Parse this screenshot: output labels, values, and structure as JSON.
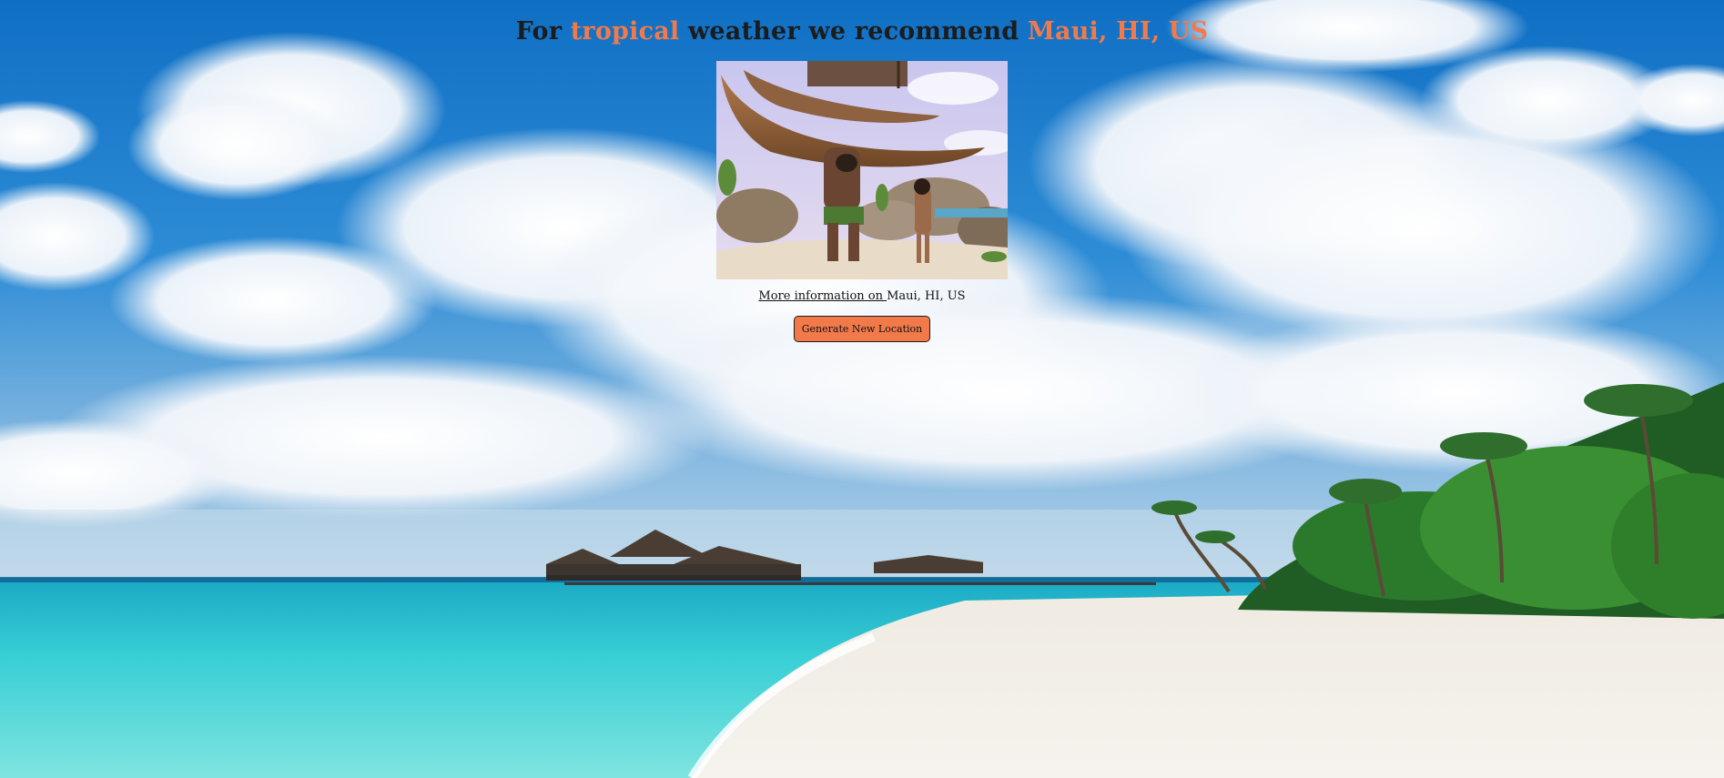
{
  "headline": {
    "prefix": "For ",
    "weather": "tropical",
    "middle": " weather we recommend ",
    "location": "Maui, HI, US"
  },
  "photo": {
    "alt_icon": "destination-photo"
  },
  "info": {
    "link_text": "More information on ",
    "location": "Maui, HI, US"
  },
  "button": {
    "label": "Generate New Location"
  },
  "colors": {
    "accent": "#f27a4a",
    "sky": "#1f7fcf",
    "sea": "#3fd0d6",
    "sand": "#f3efe6"
  }
}
